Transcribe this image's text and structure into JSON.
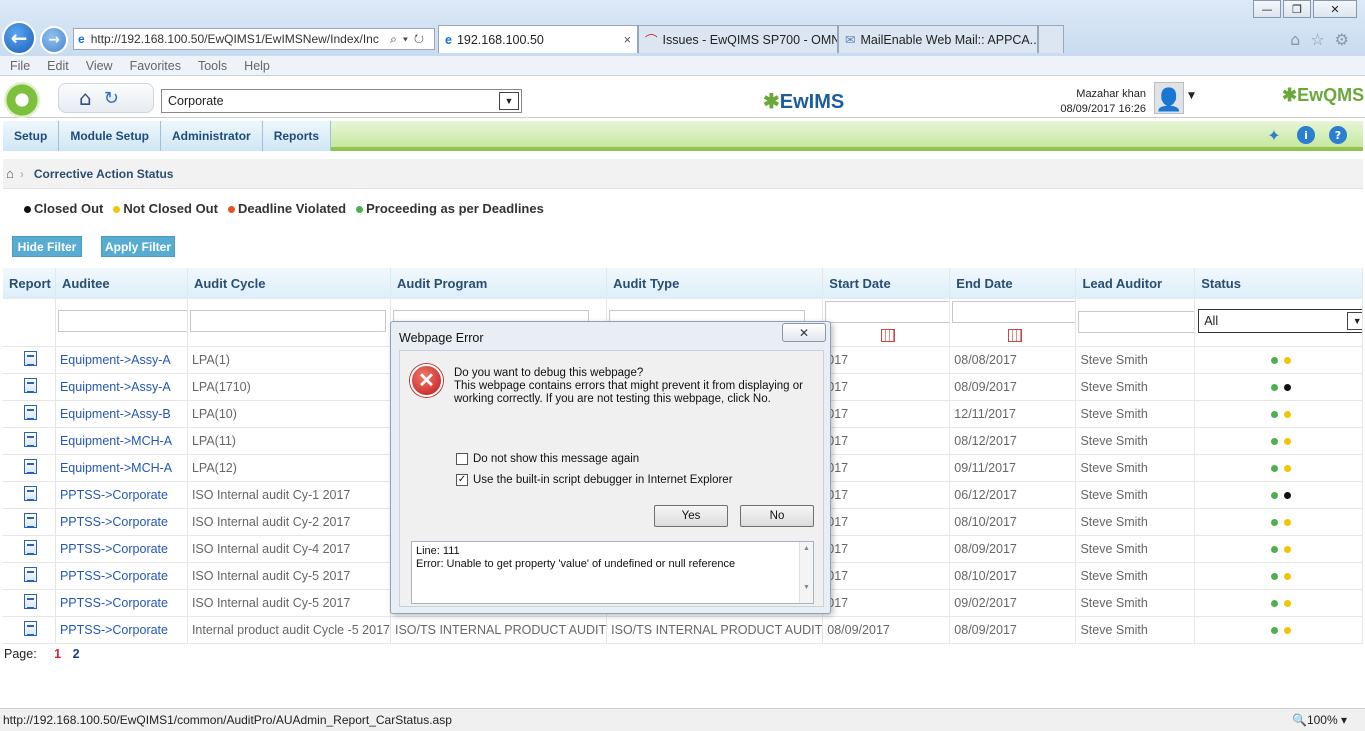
{
  "browser": {
    "url": "http://192.168.100.50/EwQIMS1/EwIMSNew/Index/Inc",
    "tabs": [
      {
        "label": "192.168.100.50",
        "close": "×"
      },
      {
        "label": "Issues - EwQIMS SP700 - OMN..."
      },
      {
        "label": "MailEnable Web Mail:: APPCA..."
      }
    ],
    "menu": [
      "File",
      "Edit",
      "View",
      "Favorites",
      "Tools",
      "Help"
    ],
    "status_url": "http://192.168.100.50/EwQIMS1/common/AuditPro/AUAdmin_Report_CarStatus.asp",
    "zoom": "100%"
  },
  "app": {
    "org_select": "Corporate",
    "brand": "EwIMS",
    "brand2": "EwQMS",
    "user_name": "Mazahar khan",
    "user_datetime": "08/09/2017 16:26",
    "nav": [
      "Setup",
      "Module Setup",
      "Administrator",
      "Reports"
    ],
    "breadcrumb": "Corrective Action Status"
  },
  "legend": [
    {
      "label": "Closed Out",
      "color": "#111111"
    },
    {
      "label": "Not Closed Out",
      "color": "#f5c400"
    },
    {
      "label": "Deadline Violated",
      "color": "#e8521c"
    },
    {
      "label": "Proceeding as per Deadlines",
      "color": "#4caf50"
    }
  ],
  "buttons": {
    "hide_filter": "Hide Filter",
    "apply_filter": "Apply Filter"
  },
  "table": {
    "headers": [
      "Report",
      "Auditee",
      "Audit Cycle",
      "Audit Program",
      "Audit Type",
      "Start Date",
      "End Date",
      "Lead Auditor",
      "Status"
    ],
    "status_filter": "All",
    "rows": [
      {
        "auditee": "Equipment->Assy-A",
        "cycle": "LPA(1)",
        "program": "",
        "type": "",
        "start": "017",
        "end": "08/08/2017",
        "lead": "Steve Smith",
        "s2": "#f5c400"
      },
      {
        "auditee": "Equipment->Assy-A",
        "cycle": "LPA(1710)",
        "program": "",
        "type": "",
        "start": "017",
        "end": "08/09/2017",
        "lead": "Steve Smith",
        "s2": "#111111"
      },
      {
        "auditee": "Equipment->Assy-B",
        "cycle": "LPA(10)",
        "program": "",
        "type": "",
        "start": "017",
        "end": "12/11/2017",
        "lead": "Steve Smith",
        "s2": "#f5c400"
      },
      {
        "auditee": "Equipment->MCH-A",
        "cycle": "LPA(11)",
        "program": "",
        "type": "",
        "start": "017",
        "end": "08/12/2017",
        "lead": "Steve Smith",
        "s2": "#f5c400"
      },
      {
        "auditee": "Equipment->MCH-A",
        "cycle": "LPA(12)",
        "program": "",
        "type": "",
        "start": "017",
        "end": "09/11/2017",
        "lead": "Steve Smith",
        "s2": "#f5c400"
      },
      {
        "auditee": "PPTSS->Corporate",
        "cycle": "ISO Internal audit Cy-1 2017",
        "program": "",
        "type": "",
        "start": "017",
        "end": "06/12/2017",
        "lead": "Steve Smith",
        "s2": "#111111"
      },
      {
        "auditee": "PPTSS->Corporate",
        "cycle": "ISO Internal audit Cy-2 2017",
        "program": "",
        "type": "",
        "start": "017",
        "end": "08/10/2017",
        "lead": "Steve Smith",
        "s2": "#f5c400"
      },
      {
        "auditee": "PPTSS->Corporate",
        "cycle": "ISO Internal audit Cy-4 2017",
        "program": "",
        "type": "",
        "start": "017",
        "end": "08/09/2017",
        "lead": "Steve Smith",
        "s2": "#f5c400"
      },
      {
        "auditee": "PPTSS->Corporate",
        "cycle": "ISO Internal audit Cy-5 2017",
        "program": "",
        "type": "",
        "start": "017",
        "end": "08/10/2017",
        "lead": "Steve Smith",
        "s2": "#f5c400"
      },
      {
        "auditee": "PPTSS->Corporate",
        "cycle": "ISO Internal audit Cy-5 2017",
        "program": "",
        "type": "",
        "start": "017",
        "end": "09/02/2017",
        "lead": "Steve Smith",
        "s2": "#f5c400"
      },
      {
        "auditee": "PPTSS->Corporate",
        "cycle": "Internal product audit Cycle -5 2017",
        "program": "ISO/TS INTERNAL PRODUCT AUDIT",
        "type": "ISO/TS INTERNAL PRODUCT AUDIT",
        "start": "08/09/2017",
        "end": "08/09/2017",
        "lead": "Steve Smith",
        "s2": "#f5c400"
      }
    ]
  },
  "pager": {
    "label": "Page:",
    "pages": [
      "1",
      "2"
    ]
  },
  "dialog": {
    "title": "Webpage Error",
    "close": "✕",
    "question": "Do you want to debug this webpage?",
    "message": "This webpage contains errors that might prevent it from displaying or working correctly. If you are not testing this webpage, click No.",
    "check1": "Do not show this message again",
    "check2": "Use the built-in script debugger in Internet Explorer",
    "yes": "Yes",
    "no": "No",
    "error_line": "Line: 111",
    "error_text": "Error: Unable to get property 'value' of undefined or null reference"
  }
}
